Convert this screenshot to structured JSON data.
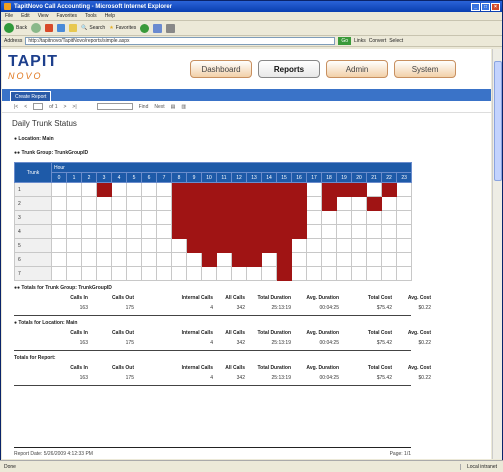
{
  "window": {
    "title": "TapitNovo Call Accounting - Microsoft Internet Explorer"
  },
  "menu": [
    "File",
    "Edit",
    "View",
    "Favorites",
    "Tools",
    "Help"
  ],
  "toolbar": {
    "back": "Back",
    "search": "Search",
    "favorites": "Favorites"
  },
  "address": {
    "label": "Address",
    "url": "http://tapitnovo/TapitNovo/reports/simple.aspx",
    "go": "Go",
    "links": "Links",
    "convert": "Convert",
    "select": "Select"
  },
  "app": {
    "logo_main": "TAPIT",
    "logo_sub": "NOVO",
    "nav": [
      "Dashboard",
      "Reports",
      "Admin",
      "System"
    ],
    "active_nav": "Reports",
    "subtab": "Create Report"
  },
  "report_toolbar": {
    "first": "|<",
    "prev": "<",
    "page": "1",
    "of": "of 1",
    "next": ">",
    "last": ">|",
    "find": "Find",
    "next_find": "Next"
  },
  "report": {
    "title": "Daily Trunk Status",
    "location": "Location: Main",
    "trunk_group": "Trunk Group: TrunkGroupID",
    "hour_label": "Hour",
    "trunk_label": "Trunk",
    "hours": [
      "0",
      "1",
      "2",
      "3",
      "4",
      "5",
      "6",
      "7",
      "8",
      "9",
      "10",
      "11",
      "12",
      "13",
      "14",
      "15",
      "16",
      "17",
      "18",
      "19",
      "20",
      "21",
      "22",
      "23"
    ],
    "trunks": [
      {
        "id": "1",
        "active": [
          3,
          8,
          9,
          10,
          11,
          12,
          13,
          14,
          15,
          16,
          18,
          19,
          20,
          22
        ]
      },
      {
        "id": "2",
        "active": [
          8,
          9,
          10,
          11,
          12,
          13,
          14,
          15,
          16,
          18,
          21
        ]
      },
      {
        "id": "3",
        "active": [
          8,
          9,
          10,
          11,
          12,
          13,
          14,
          15,
          16
        ]
      },
      {
        "id": "4",
        "active": [
          8,
          9,
          10,
          11,
          12,
          13,
          14,
          15,
          16
        ]
      },
      {
        "id": "5",
        "active": [
          9,
          10,
          11,
          12,
          13,
          14,
          15
        ]
      },
      {
        "id": "6",
        "active": [
          10,
          12,
          13,
          15
        ]
      },
      {
        "id": "7",
        "active": [
          15
        ]
      }
    ]
  },
  "totals_columns": [
    "Calls In",
    "Calls Out",
    "Internal Calls",
    "All Calls",
    "Total Duration",
    "Avg. Duration",
    "Total Cost",
    "Avg. Cost"
  ],
  "totals": [
    {
      "label": "Totals for Trunk Group: TrunkGroupID",
      "values": [
        "163",
        "175",
        "4",
        "342",
        "25:13:19",
        "00:04:25",
        "$75.42",
        "$0.22"
      ]
    },
    {
      "label": "Totals for Location: Main",
      "values": [
        "163",
        "175",
        "4",
        "342",
        "25:13:19",
        "00:04:25",
        "$75.42",
        "$0.22"
      ]
    },
    {
      "label": "Totals for Report:",
      "values": [
        "163",
        "175",
        "4",
        "342",
        "25:13:19",
        "00:04:25",
        "$75.42",
        "$0.22"
      ]
    }
  ],
  "footer": {
    "date": "Report Date: 5/26/2009 4:12:33 PM",
    "page": "Page: 1/1"
  },
  "status": {
    "text": "Done",
    "zone": "Local intranet"
  },
  "colors": {
    "active_cell": "#a01414",
    "grid_header": "#1e5aa8",
    "app_bar": "#3a73c8"
  }
}
